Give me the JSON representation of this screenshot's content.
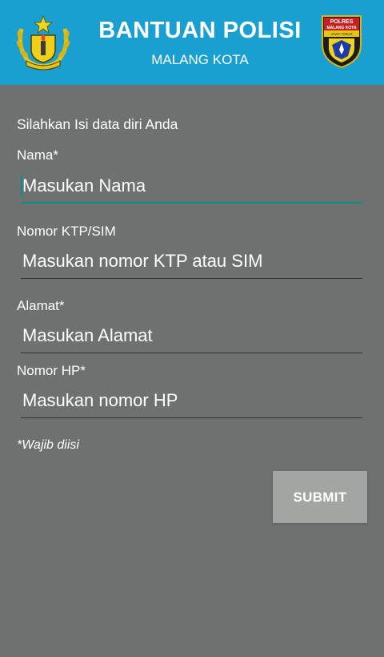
{
  "header": {
    "title": "BANTUAN POLISI",
    "subtitle": "MALANG KOTA",
    "background": "#1aa0d0",
    "logo_left_icon": "police-emblem-icon",
    "logo_right": {
      "icon": "polres-badge-icon",
      "line1": "POLRES",
      "line2": "MALANG KOTA",
      "line3": "JAWA TIMUR"
    }
  },
  "form": {
    "intro": "Silahkan Isi data diri Anda",
    "fields": [
      {
        "label": "Nama*",
        "placeholder": "Masukan Nama",
        "value": "",
        "focused": true
      },
      {
        "label": "Nomor KTP/SIM",
        "placeholder": "Masukan nomor KTP atau SIM",
        "value": ""
      },
      {
        "label": "Alamat*",
        "placeholder": "Masukan Alamat",
        "value": ""
      },
      {
        "label": "Nomor HP*",
        "placeholder": "Masukan nomor HP",
        "value": ""
      }
    ],
    "required_note": "*Wajib diisi",
    "submit_label": "SUBMIT"
  },
  "colors": {
    "background": "#6d7170",
    "accent": "#0e8f86",
    "button": "#a3a5a3"
  }
}
